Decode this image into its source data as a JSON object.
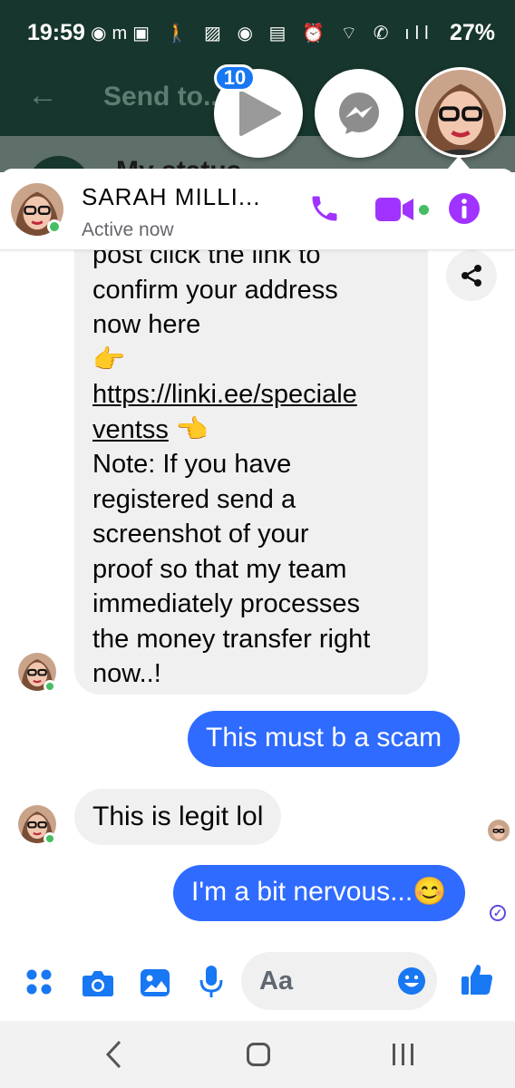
{
  "status_bar": {
    "time": "19:59",
    "battery": "27%",
    "icons": "m"
  },
  "underlying_app": {
    "title": "Send to...",
    "status_label": "My status"
  },
  "chat_heads": {
    "unread_badge": "10"
  },
  "chat": {
    "contact_name": "SARAH MILLI...",
    "contact_status": "Active now"
  },
  "messages": {
    "partial_top": "post click the link to",
    "line_2": "confirm your address",
    "line_3": "now here",
    "emoji_pointing_right": "👉",
    "link_part1": "https://linki.ee/speciale",
    "link_part2": "ventss",
    "emoji_pointing_left": "👈",
    "note_lines": [
      "Note: If you have",
      "registered send a",
      "screenshot of your",
      "proof so that my team",
      "immediately processes",
      "the money transfer right",
      "now..!"
    ],
    "out_1": "This must b a scam",
    "in_1": "This is legit lol",
    "out_2": "I'm a bit nervous...😊"
  },
  "composer": {
    "placeholder": "Aa"
  },
  "colors": {
    "messenger_blue": "#2f6bff",
    "accent_purple": "#a033ff",
    "online_green": "#45bd62",
    "header_green": "#17362d"
  }
}
